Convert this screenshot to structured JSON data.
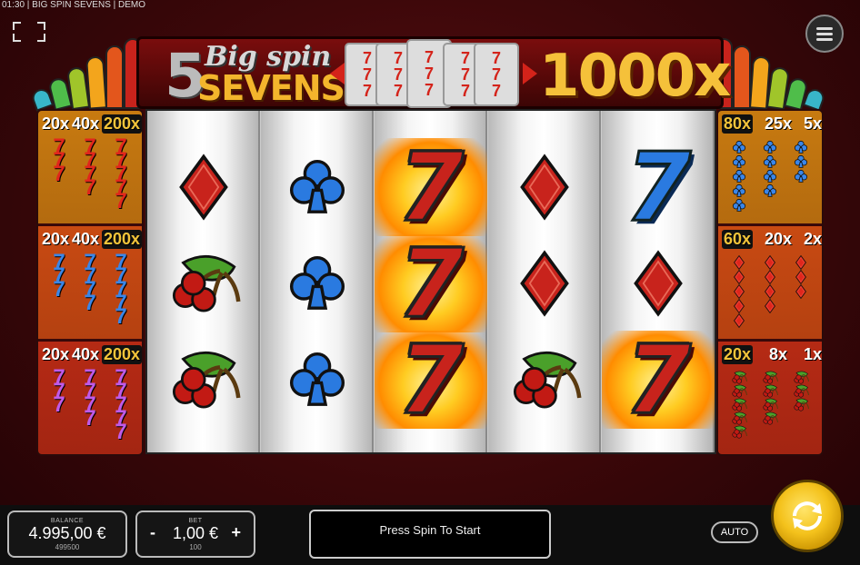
{
  "window": {
    "title": "01:30 | BIG SPIN SEVENS | DEMO"
  },
  "icons": {
    "fullscreen": "fullscreen-icon",
    "menu": "hamburger-menu-icon",
    "spin": "spin-arrows-icon"
  },
  "logo": {
    "number": "5",
    "big_spin": "Big spin",
    "sevens": "SEVENS",
    "multiplier": "1000x"
  },
  "colors": {
    "red_seven": "#c8231c",
    "blue_seven": "#2a7ae0",
    "purple_seven": "#b04ee0",
    "gold": "#f3c43a"
  },
  "paytable_left": [
    {
      "symbol": "red seven",
      "color": "#e1261c",
      "bg": "#c77a10",
      "pays": [
        "20x",
        "40x",
        "200x"
      ]
    },
    {
      "symbol": "blue seven",
      "color": "#3a86e8",
      "bg": "#c84a12",
      "pays": [
        "20x",
        "40x",
        "200x"
      ]
    },
    {
      "symbol": "purple seven",
      "color": "#c05ae8",
      "bg": "#b52a14",
      "pays": [
        "20x",
        "40x",
        "200x"
      ]
    }
  ],
  "paytable_right": [
    {
      "symbol": "club",
      "color": "#3a86e8",
      "bg": "#c77a10",
      "pays": [
        "80x",
        "25x",
        "5x"
      ]
    },
    {
      "symbol": "diamond",
      "color": "#e1261c",
      "bg": "#c84a12",
      "pays": [
        "60x",
        "20x",
        "2x"
      ]
    },
    {
      "symbol": "cherry",
      "color": "#c8231c",
      "bg": "#b52a14",
      "pays": [
        "20x",
        "8x",
        "1x"
      ]
    }
  ],
  "reels": [
    [
      "diamond",
      "cherry",
      "cherry"
    ],
    [
      "club",
      "club",
      "club"
    ],
    [
      "seven-red-flame",
      "seven-red-flame",
      "seven-red-flame"
    ],
    [
      "diamond",
      "diamond",
      "cherry"
    ],
    [
      "seven-blue",
      "diamond",
      "seven-red-flame"
    ]
  ],
  "balance": {
    "label": "BALANCE",
    "value": "4.995,00 €",
    "credits": "499500"
  },
  "bet": {
    "label": "BET",
    "value": "1,00 €",
    "credits": "100",
    "minus": "-",
    "plus": "+"
  },
  "message": "Press Spin To Start",
  "auto_label": "AUTO"
}
